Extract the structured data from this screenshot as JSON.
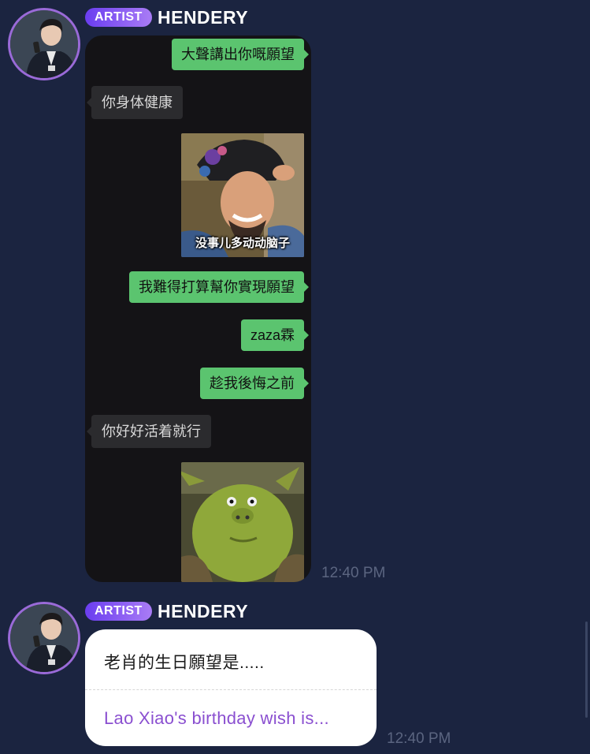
{
  "messages": [
    {
      "badge": "ARTIST",
      "sender": "HENDERY",
      "screenshot": {
        "bubbles": [
          {
            "side": "out",
            "text": "大聲講出你嘅願望"
          },
          {
            "side": "in",
            "text": "你身体健康"
          },
          {
            "side": "out",
            "sticker_caption": "没事儿多动动脑子"
          },
          {
            "side": "out",
            "text": "我難得打算幫你實現願望"
          },
          {
            "side": "out",
            "text": "zaza霖"
          },
          {
            "side": "out",
            "text": "趁我後悔之前"
          },
          {
            "side": "in",
            "text": "你好好活着就行"
          }
        ]
      },
      "time": "12:40 PM"
    },
    {
      "badge": "ARTIST",
      "sender": "HENDERY",
      "original_text": "老肖的生日願望是.....",
      "translation": "Lao Xiao's birthday wish is...",
      "time": "12:40 PM"
    }
  ],
  "colors": {
    "background": "#1b2440",
    "badge_gradient_start": "#6a3df0",
    "badge_gradient_end": "#a97cf5",
    "outgoing_bubble": "#5bc46f",
    "incoming_bubble": "#2b2b2e",
    "translation_text": "#8a4fd0",
    "timestamp": "#5b6580"
  }
}
